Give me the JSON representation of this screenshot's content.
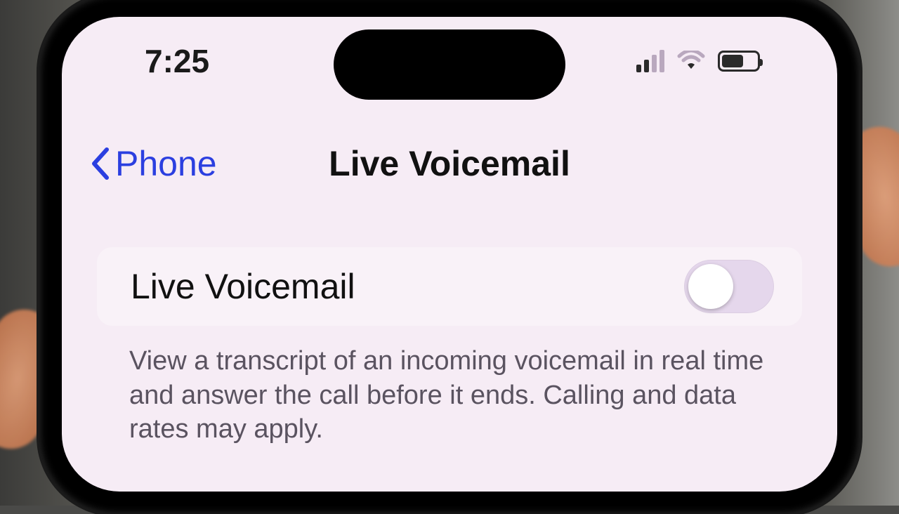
{
  "status": {
    "time": "7:25"
  },
  "nav": {
    "back_label": "Phone",
    "title": "Live Voicemail"
  },
  "setting": {
    "label": "Live Voicemail",
    "enabled": false,
    "description": "View a transcript of an incoming voicemail in real time and answer the call before it ends. Calling and data rates may apply."
  }
}
